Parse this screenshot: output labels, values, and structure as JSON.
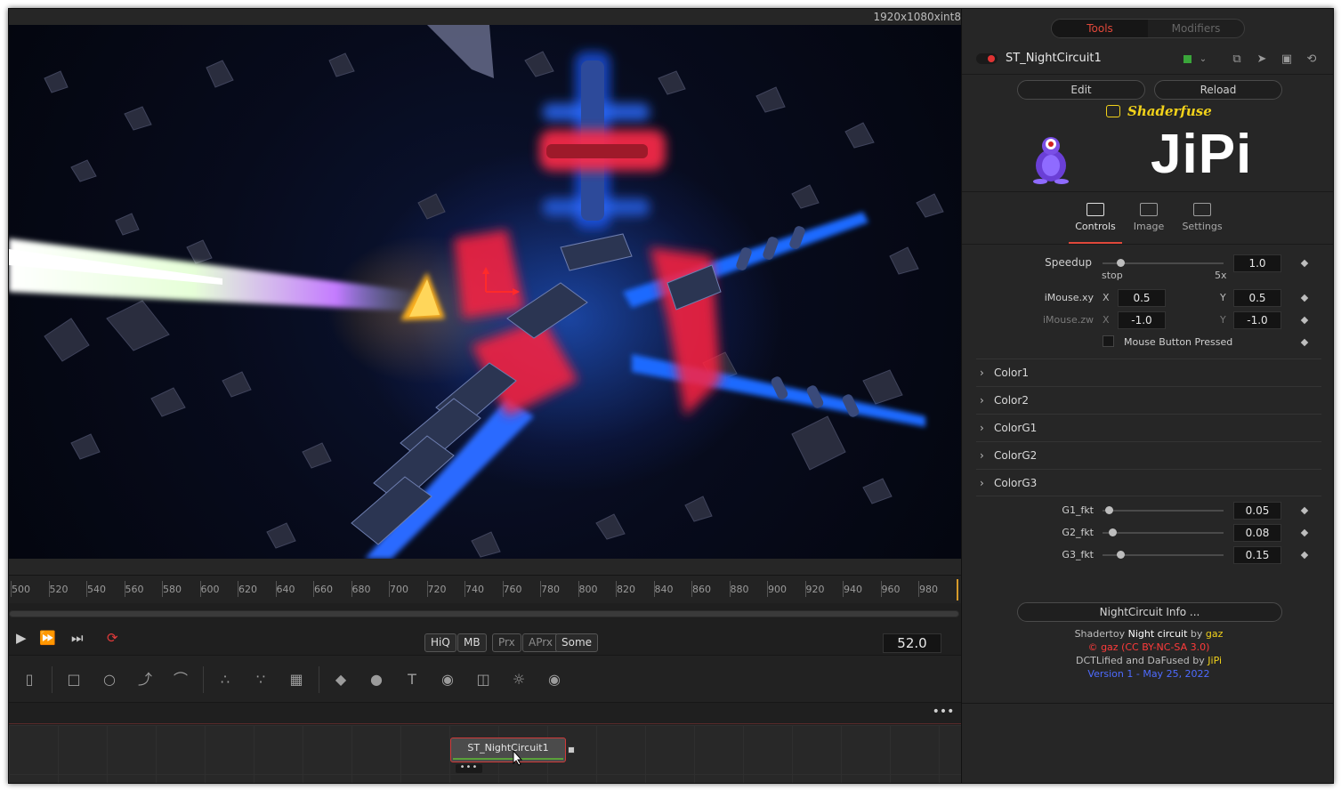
{
  "viewer": {
    "resolution": "1920x1080xint8"
  },
  "timeline": {
    "ticks": [
      "500",
      "520",
      "540",
      "560",
      "580",
      "600",
      "620",
      "640",
      "660",
      "680",
      "700",
      "720",
      "740",
      "760",
      "780",
      "800",
      "820",
      "840",
      "860",
      "880",
      "900",
      "920",
      "940",
      "960",
      "980"
    ]
  },
  "transport": {
    "quality_buttons": [
      "HiQ",
      "MB",
      "Prx",
      "APrx",
      "Some"
    ],
    "current_frame": "52.0"
  },
  "flow": {
    "node_label": "ST_NightCircuit1",
    "more_label": "•••"
  },
  "inspector": {
    "tabs": {
      "tools": "Tools",
      "modifiers": "Modifiers"
    },
    "tool_name": "ST_NightCircuit1",
    "edit_label": "Edit",
    "reload_label": "Reload",
    "brand": "Shaderfuse",
    "logo_text": "JiPi",
    "section_tabs": {
      "controls": "Controls",
      "image": "Image",
      "settings": "Settings"
    },
    "controls": {
      "speedup": {
        "label": "Speedup",
        "value": "1.0",
        "min_label": "stop",
        "max_label": "5x",
        "level": 0.15
      },
      "imouse_xy": {
        "label": "iMouse.xy",
        "x_label": "X",
        "x_value": "0.5",
        "y_label": "Y",
        "y_value": "0.5"
      },
      "imouse_zw": {
        "label": "iMouse.zw",
        "x_label": "X",
        "x_value": "-1.0",
        "y_label": "Y",
        "y_value": "-1.0"
      },
      "mouse_button": {
        "label": "Mouse Button Pressed"
      },
      "groups": [
        "Color1",
        "Color2",
        "ColorG1",
        "ColorG2",
        "ColorG3"
      ],
      "g1": {
        "label": "G1_fkt",
        "value": "0.05",
        "level": 0.05
      },
      "g2": {
        "label": "G2_fkt",
        "value": "0.08",
        "level": 0.08
      },
      "g3": {
        "label": "G3_fkt",
        "value": "0.15",
        "level": 0.15
      }
    },
    "info_button": "NightCircuit Info ...",
    "credits": {
      "l1a": "Shadertoy",
      "l1b": "Night circuit",
      "l1c": "by",
      "l1d": "gaz",
      "l2": "© gaz (CC BY-NC-SA 3.0)",
      "l3a": "DCTLified and DaFused by",
      "l3b": "JiPi",
      "l4": "Version 1 - May 25, 2022"
    }
  },
  "colors": {
    "accent_red": "#e0483a",
    "brand_yellow": "#f2d21a",
    "version_blue": "#4e6bff"
  }
}
